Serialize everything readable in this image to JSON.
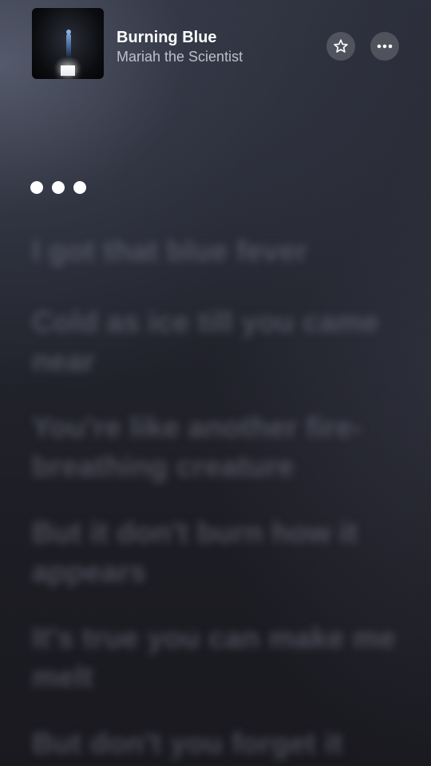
{
  "now_playing": {
    "title": "Burning Blue",
    "artist": "Mariah the Scientist",
    "artwork_icon": "album-artwork"
  },
  "actions": {
    "favorite_icon": "star-icon",
    "more_icon": "ellipsis-icon"
  },
  "lyrics": {
    "lines": [
      "I got that blue fever",
      "Cold as ice till you came near",
      "You're like another fire-breathing creature",
      "But it don't burn how it appears",
      "It's true you can make me melt",
      "But don't you forget it"
    ]
  }
}
